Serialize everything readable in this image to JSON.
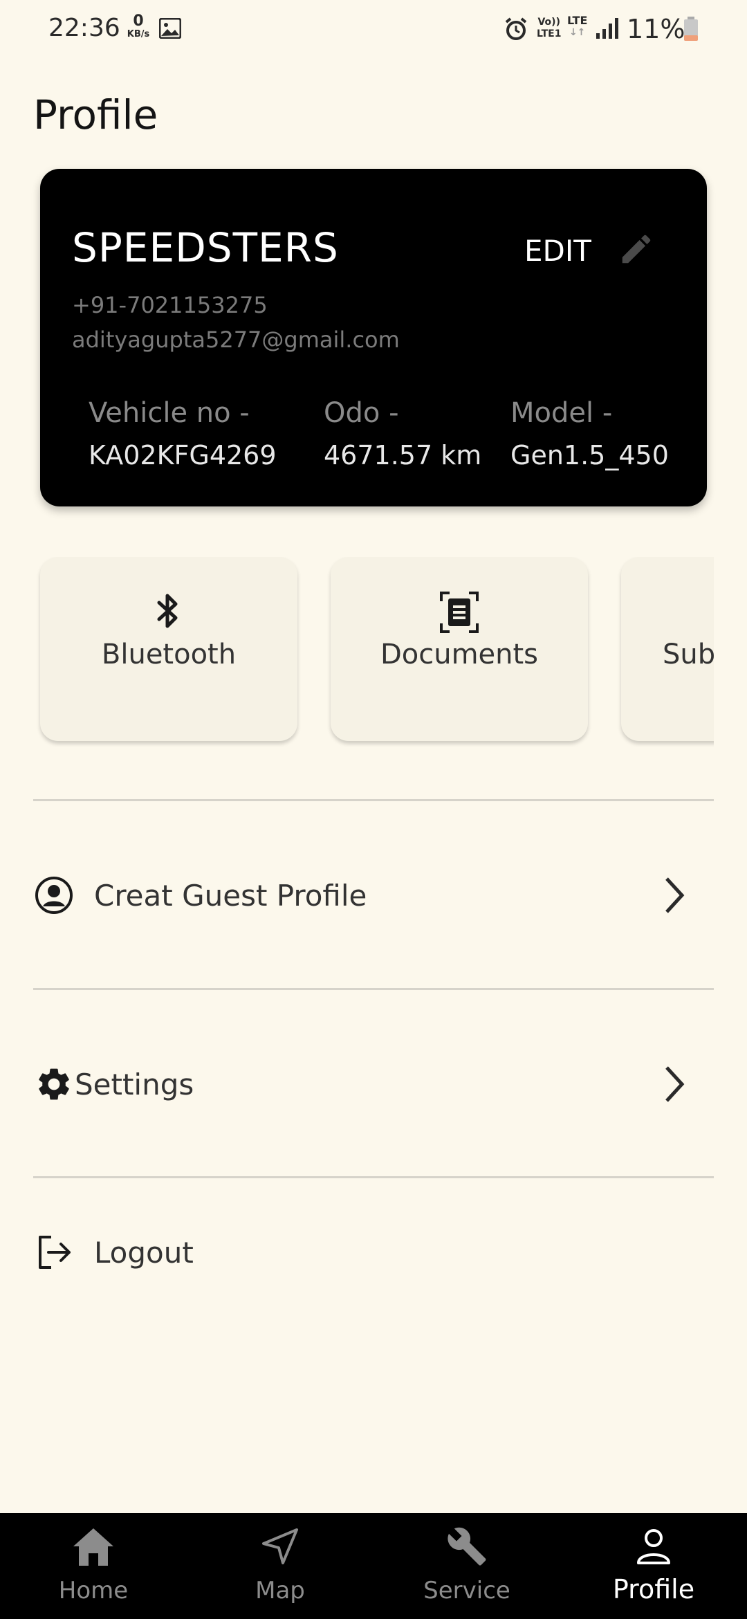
{
  "status_bar": {
    "time": "22:36",
    "net_speed_value": "0",
    "net_speed_unit": "KB/s",
    "volte_top": "Vo))",
    "volte_bottom": "LTE1",
    "lte": "LTE",
    "battery": "11%"
  },
  "page": {
    "title": "Profile"
  },
  "profile_card": {
    "name": "SPEEDSTERS",
    "edit_label": "EDIT",
    "phone": "+91-7021153275",
    "email": "adityagupta5277@gmail.com",
    "vehicle_label": "Vehicle no -",
    "vehicle_value": "KA02KFG4269",
    "odo_label": "Odo -",
    "odo_value": "4671.57 km",
    "model_label": "Model -",
    "model_value": "Gen1.5_450"
  },
  "tiles": [
    {
      "label": "Bluetooth",
      "icon": "bluetooth-icon"
    },
    {
      "label": "Documents",
      "icon": "document-scan-icon"
    },
    {
      "label": "Sub..."
    }
  ],
  "menu": {
    "guest_profile": "Creat Guest Profile",
    "settings": "Settings",
    "logout": "Logout"
  },
  "bottom_nav": {
    "home": "Home",
    "map": "Map",
    "service": "Service",
    "profile": "Profile",
    "active": "profile"
  },
  "colors": {
    "background": "#fcf8ec",
    "card": "#000000",
    "tile": "#f6f2e5",
    "nav_bar": "#000000",
    "battery_low": "#f0a07a"
  }
}
